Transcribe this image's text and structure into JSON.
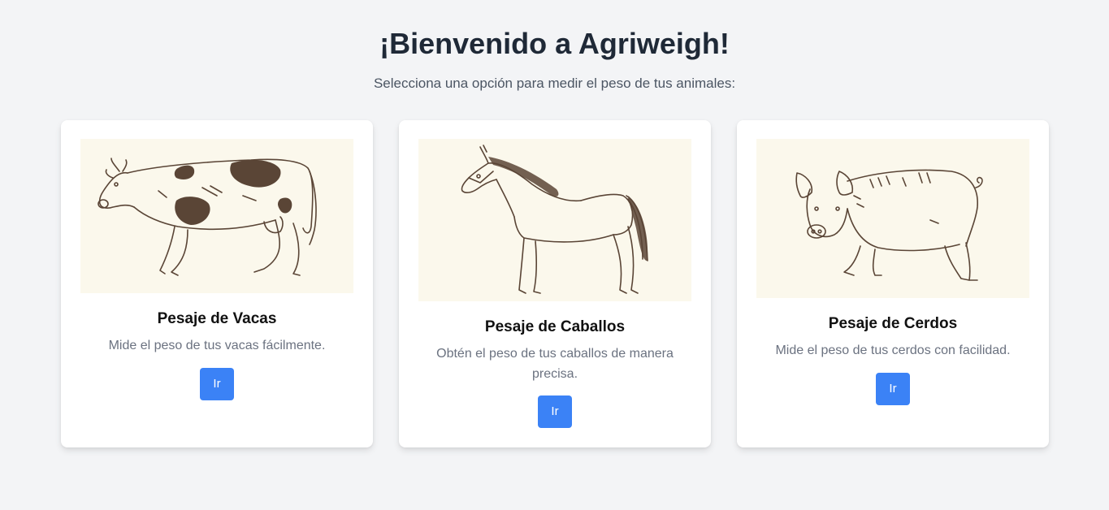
{
  "header": {
    "title": "¡Bienvenido a Agriweigh!",
    "subtitle": "Selecciona una opción para medir el peso de tus animales:"
  },
  "cards": [
    {
      "title": "Pesaje de Vacas",
      "description": "Mide el peso de tus vacas fácilmente.",
      "button_label": "Ir",
      "image": "cow-sketch"
    },
    {
      "title": "Pesaje de Caballos",
      "description": "Obtén el peso de tus caballos de manera precisa.",
      "button_label": "Ir",
      "image": "horse-sketch"
    },
    {
      "title": "Pesaje de Cerdos",
      "description": "Mide el peso de tus cerdos con facilidad.",
      "button_label": "Ir",
      "image": "pig-sketch"
    }
  ],
  "colors": {
    "background": "#f3f4f6",
    "card": "#ffffff",
    "button": "#3b82f6",
    "illustration_bg": "#fbf8ec",
    "ink": "#5a4536"
  }
}
